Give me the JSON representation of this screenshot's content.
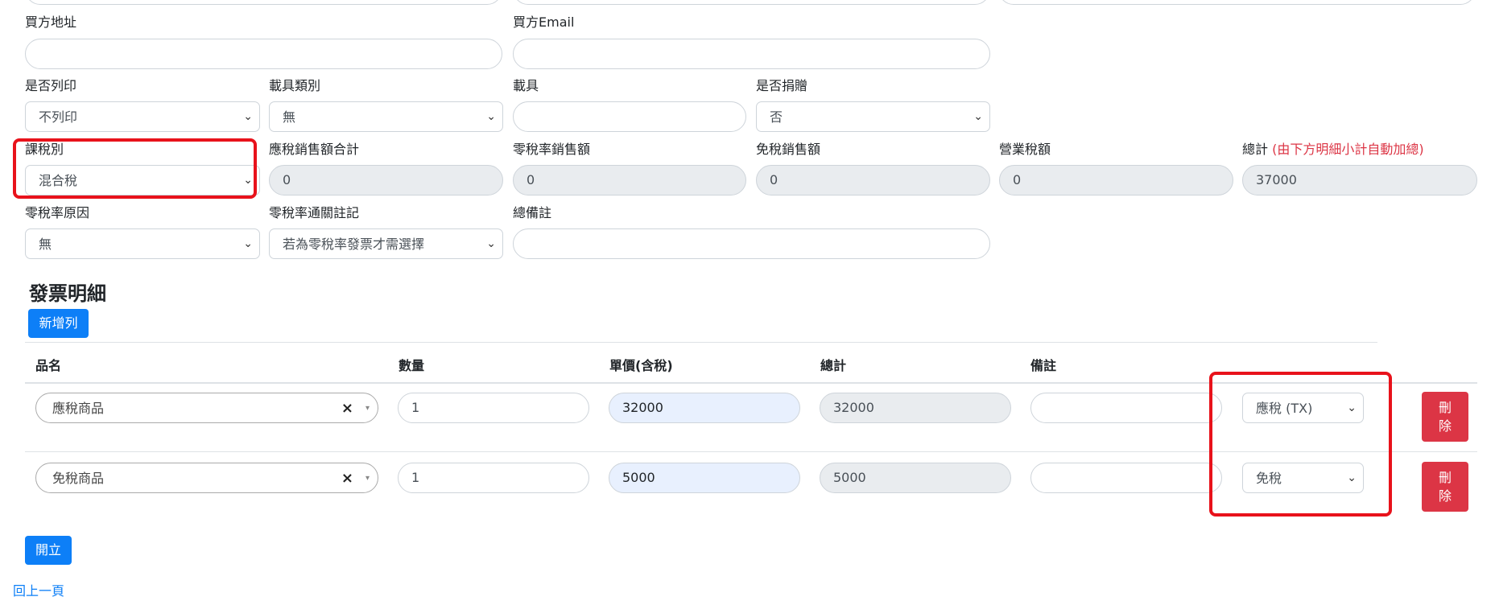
{
  "form": {
    "buyer_address_label": "買方地址",
    "buyer_email_label": "買方Email",
    "print_label": "是否列印",
    "print_value": "不列印",
    "carrier_type_label": "載具類別",
    "carrier_type_value": "無",
    "carrier_label": "載具",
    "donate_label": "是否捐贈",
    "donate_value": "否",
    "tax_type_label": "課稅別",
    "tax_type_value": "混合稅",
    "taxable_sales_label": "應稅銷售額合計",
    "taxable_sales_value": "0",
    "zero_rate_sales_label": "零稅率銷售額",
    "zero_rate_sales_value": "0",
    "tax_free_sales_label": "免稅銷售額",
    "tax_free_sales_value": "0",
    "business_tax_label": "營業稅額",
    "business_tax_value": "0",
    "total_label": "總計",
    "total_note": "(由下方明細小計自動加總)",
    "total_value": "37000",
    "zero_reason_label": "零稅率原因",
    "zero_reason_value": "無",
    "zero_customs_label": "零稅率通關註記",
    "zero_customs_value": "若為零稅率發票才需選擇",
    "remark_label": "總備註"
  },
  "details": {
    "title": "發票明細",
    "add_row_label": "新增列",
    "headers": [
      "品名",
      "數量",
      "單價(含稅)",
      "總計",
      "備註"
    ],
    "rows": [
      {
        "item": "應稅商品",
        "qty": "1",
        "price": "32000",
        "total": "32000",
        "tax": "應稅 (TX)",
        "delete": "刪除"
      },
      {
        "item": "免稅商品",
        "qty": "1",
        "price": "5000",
        "total": "5000",
        "tax": "免稅",
        "delete": "刪除"
      }
    ]
  },
  "actions": {
    "issue_label": "開立",
    "back_label": "回上一頁"
  },
  "icons": {
    "clear": "×",
    "dropdown": "▾",
    "chevron": "⌄"
  },
  "colors": {
    "primary": "#0d7ff7",
    "danger": "#dc3545",
    "highlight": "#e8121b"
  }
}
